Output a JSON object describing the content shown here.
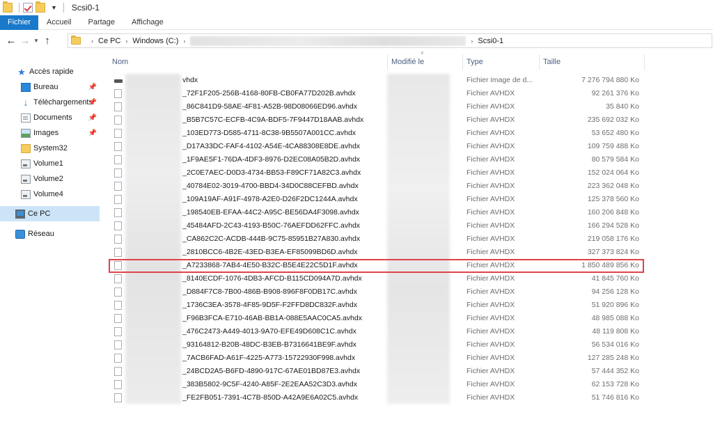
{
  "window": {
    "title": "Scsi0-1"
  },
  "ribbon": {
    "tabs": [
      "Fichier",
      "Accueil",
      "Partage",
      "Affichage"
    ]
  },
  "address": {
    "crumbs": [
      "Ce PC",
      "Windows (C:)",
      "Scsi0-1"
    ]
  },
  "sidebar": {
    "quick_access": "Accès rapide",
    "items": [
      {
        "label": "Bureau",
        "icon": "desktop-icon",
        "pinned": true
      },
      {
        "label": "Téléchargements",
        "icon": "download-icon",
        "pinned": true
      },
      {
        "label": "Documents",
        "icon": "documents-icon",
        "pinned": true
      },
      {
        "label": "Images",
        "icon": "pictures-icon",
        "pinned": true
      },
      {
        "label": "System32",
        "icon": "folder-icon",
        "pinned": false
      },
      {
        "label": "Volume1",
        "icon": "volume-icon",
        "pinned": false
      },
      {
        "label": "Volume2",
        "icon": "volume-icon",
        "pinned": false
      },
      {
        "label": "Volume4",
        "icon": "volume-icon",
        "pinned": false
      }
    ],
    "this_pc": "Ce PC",
    "network": "Réseau"
  },
  "columns": {
    "name": "Nom",
    "modified": "Modifié le",
    "type": "Type",
    "size": "Taille"
  },
  "files": [
    {
      "name": "vhdx",
      "type": "Fichier image de d...",
      "size": "7 276 794 880 Ko"
    },
    {
      "name": "_72F1F205-256B-4168-80FB-CB0FA77D202B.avhdx",
      "type": "Fichier AVHDX",
      "size": "92 261 376 Ko"
    },
    {
      "name": "_86C841D9-58AE-4F81-A52B-98D08066ED96.avhdx",
      "type": "Fichier AVHDX",
      "size": "35 840 Ko"
    },
    {
      "name": "_B5B7C57C-ECFB-4C9A-BDF5-7F9447D18AAB.avhdx",
      "type": "Fichier AVHDX",
      "size": "235 692 032 Ko"
    },
    {
      "name": "_103ED773-D585-4711-8C38-9B5507A001CC.avhdx",
      "type": "Fichier AVHDX",
      "size": "53 652 480 Ko"
    },
    {
      "name": "_D17A33DC-FAF4-4102-A54E-4CA88308E8DE.avhdx",
      "type": "Fichier AVHDX",
      "size": "109 759 488 Ko"
    },
    {
      "name": "_1F9AE5F1-76DA-4DF3-8976-D2EC08A05B2D.avhdx",
      "type": "Fichier AVHDX",
      "size": "80 579 584 Ko"
    },
    {
      "name": "_2C0E7AEC-D0D3-4734-BB53-F89CF71A82C3.avhdx",
      "type": "Fichier AVHDX",
      "size": "152 024 064 Ko"
    },
    {
      "name": "_40784E02-3019-4700-BBD4-34D0C88CEFBD.avhdx",
      "type": "Fichier AVHDX",
      "size": "223 362 048 Ko"
    },
    {
      "name": "_109A19AF-A91F-4978-A2E0-D26F2DC1244A.avhdx",
      "type": "Fichier AVHDX",
      "size": "125 378 560 Ko"
    },
    {
      "name": "_198540EB-EFAA-44C2-A95C-BE56DA4F3098.avhdx",
      "type": "Fichier AVHDX",
      "size": "160 206 848 Ko"
    },
    {
      "name": "_45484AFD-2C43-4193-B50C-76AEFDD62FFC.avhdx",
      "type": "Fichier AVHDX",
      "size": "166 294 528 Ko"
    },
    {
      "name": "_CA862C2C-ACDB-444B-9C75-85951B27A830.avhdx",
      "type": "Fichier AVHDX",
      "size": "219 058 176 Ko"
    },
    {
      "name": "_2810BCC6-4B2E-43ED-B3EA-EF85099BD6D.avhdx",
      "type": "Fichier AVHDX",
      "size": "327 373 824 Ko"
    },
    {
      "name": "_A7233868-7AB4-4E50-B32C-B5E4E22C5D1F.avhdx",
      "type": "Fichier AVHDX",
      "size": "1 850 489 856 Ko",
      "highlighted": true
    },
    {
      "name": "_8140ECDF-1076-4DB3-AFCD-B115CD094A7D.avhdx",
      "type": "Fichier AVHDX",
      "size": "41 845 760 Ko"
    },
    {
      "name": "_D884F7C8-7B00-486B-B908-896F8F0DB17C.avhdx",
      "type": "Fichier AVHDX",
      "size": "94 256 128 Ko"
    },
    {
      "name": "_1736C3EA-3578-4F85-9D5F-F2FFD8DC832F.avhdx",
      "type": "Fichier AVHDX",
      "size": "51 920 896 Ko"
    },
    {
      "name": "_F96B3FCA-E710-46AB-BB1A-088E5AAC0CA5.avhdx",
      "type": "Fichier AVHDX",
      "size": "48 985 088 Ko"
    },
    {
      "name": "_476C2473-A449-4013-9A70-EFE49D608C1C.avhdx",
      "type": "Fichier AVHDX",
      "size": "48 119 808 Ko"
    },
    {
      "name": "_93164812-B20B-48DC-B3EB-B7316641BE9F.avhdx",
      "type": "Fichier AVHDX",
      "size": "56 534 016 Ko"
    },
    {
      "name": "_7ACB6FAD-A61F-4225-A773-15722930F998.avhdx",
      "type": "Fichier AVHDX",
      "size": "127 285 248 Ko"
    },
    {
      "name": "_24BCD2A5-B6FD-4890-917C-67AE01BD87E3.avhdx",
      "type": "Fichier AVHDX",
      "size": "57 444 352 Ko"
    },
    {
      "name": "_383B5802-9C5F-4240-A85F-2E2EAA52C3D3.avhdx",
      "type": "Fichier AVHDX",
      "size": "62 153 728 Ko"
    },
    {
      "name": "_FE2FB051-7391-4C7B-850D-A42A9E6A02C5.avhdx",
      "type": "Fichier AVHDX",
      "size": "51 746 816 Ko"
    }
  ],
  "colors": {
    "accent": "#1979ca",
    "selection": "#cce4f7",
    "highlight": "#e0424b"
  }
}
